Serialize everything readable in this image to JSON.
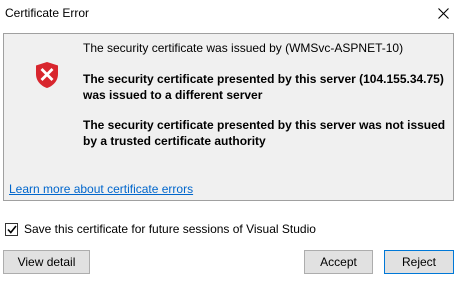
{
  "window": {
    "title": "Certificate Error",
    "close_icon": "close-icon"
  },
  "panel": {
    "icon": "shield-error-icon",
    "issuer_line": "The security certificate was issued by (WMSvc-ASPNET-10)",
    "error1_line1": "The security certificate presented by this server (104.155.34.75)",
    "error1_line2": "was issued to a different server",
    "error2_line1": "The security certificate presented by this server was not issued",
    "error2_line2": "by a trusted certificate authority",
    "learn_more_link": "Learn more about certificate errors"
  },
  "save_option": {
    "label": "Save this certificate for future sessions of Visual Studio",
    "checked": true
  },
  "buttons": {
    "view_detail": "View detail",
    "accept": "Accept",
    "reject": "Reject"
  },
  "colors": {
    "shield_red": "#d8262e",
    "link": "#0066cc",
    "panel_bg": "#f0f0f0",
    "focus_border": "#0078d7"
  }
}
